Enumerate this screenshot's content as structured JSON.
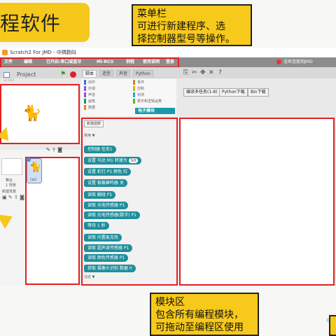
{
  "page_title": "程软件",
  "annotation_menu": {
    "line1": "菜单栏",
    "line2": "可进行新建程序、选",
    "line3": "择控制器型号等操作。"
  },
  "annotation_blocks": {
    "line1": "模块区",
    "line2": "包含所有编程模块，",
    "line3": "可拖动至编程区使用"
  },
  "window": {
    "title": "Scratch2 For JMD - 中隅数码",
    "menu": [
      "文件",
      "编辑",
      "已开启:串口或蓝牙",
      "Mi-RCU",
      "例程",
      "使用说明",
      "登录"
    ],
    "save_status": "没有连接到JMD",
    "toolbar_buttons": [
      "编译多任务(1-8)",
      "Python下载",
      "Bin下载"
    ]
  },
  "stage": {
    "project_name": "Project",
    "project_by": "v2.33.6"
  },
  "sprites": {
    "stage_label": "舞台",
    "stage_count": "1 背景",
    "new_backdrop": "新建背景",
    "sprite_name": "Cat1"
  },
  "tabs": [
    "脚本",
    "造型",
    "声音",
    "Python"
  ],
  "categories_left": [
    "动作",
    "外观",
    "声音",
    "画笔",
    "数据"
  ],
  "categories_right": [
    "事件",
    "控制",
    "侦测",
    "数字和逻辑运算",
    "电子模块"
  ],
  "blocks": {
    "new_module": "新建函数",
    "group_label": "常用 ▼",
    "items": [
      "控制器 任务1",
      "设置 马达 M1 转速为",
      "设置 彩灯 P1 颜色 红",
      "设置 板载蜂鸣器 关",
      "读取 触碰 P1",
      "读取 光电传感器 P1",
      "读取 光电传感器(数字) P1",
      "等待 1 秒",
      "读取 内置麦克风",
      "读取 超声波传感器 P1",
      "读取 颜色传感器 P1",
      "获取 摄像头识别 数据 0"
    ],
    "values": {
      "speed": "50",
      "wait": "1",
      "data": "0"
    },
    "footer_label": "马达 ▼"
  },
  "colors": {
    "accent_yellow": "#f5c81b",
    "highlight_red": "#e42020",
    "block_teal": "#1f8e9c"
  }
}
